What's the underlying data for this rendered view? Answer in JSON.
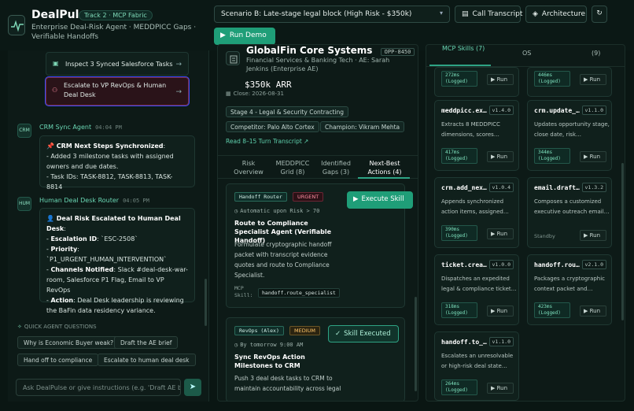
{
  "header": {
    "app_name": "DealPulse",
    "track_badge": "Track 2 · MCP Fabric",
    "subtitle": "Enterprise Deal-Risk Agent · MEDDPICC Gaps · Verifiable Handoffs",
    "scenario_select": "Scenario B: Late-stage legal block (High Risk - $350k)",
    "call_transcript_button": "Call Transcript",
    "architecture_button": "Architecture",
    "run_demo_button": "Run Demo"
  },
  "chat": {
    "tasks": [
      {
        "label": "Inspect 3 Synced Salesforce Tasks"
      },
      {
        "label": "Escalate to VP RevOps & Human Deal Desk"
      }
    ],
    "messages": [
      {
        "avatar": "CRM",
        "sender": "CRM Sync Agent",
        "time": "04:04 PM",
        "title": "📌 CRM Next Steps Synchronized",
        "lines": [
          "- Added 3 milestone tasks with assigned owners and due dates.",
          "- Task IDs: TASK-8812, TASK-8813, TASK-8814"
        ]
      },
      {
        "avatar": "HUM",
        "sender": "Human Deal Desk Router",
        "time": "04:05 PM",
        "title": "👤 Deal Risk Escalated to Human Deal Desk",
        "escalation_label": "Escalation ID",
        "escalation_value": "ESC-2508",
        "priority_label": "Priority",
        "priority_value": "P1_URGENT_HUMAN_INTERVENTION",
        "channels_label": "Channels Notified",
        "channels_value": "Slack #deal-desk-war-room, Salesforce P1 Flag, Email to VP RevOps",
        "action_label": "Action",
        "action_value": "Deal Desk leadership is reviewing the BaFin data residency variance."
      }
    ],
    "quick_questions_header": "QUICK AGENT QUESTIONS",
    "quick_questions": [
      "Why is Economic Buyer weak?",
      "Draft the AE brief",
      "Hand off to compliance",
      "Escalate to human deal desk"
    ],
    "input_placeholder": "Ask DealPulse or give instructions (e.g. 'Draft AE brie"
  },
  "account": {
    "name": "GlobalFin Core Systems",
    "id_badge": "OPP-8450",
    "industry_line": "Financial Services & Banking Tech · AE: Sarah Jenkins (Enterprise AE)",
    "arr": "$350k ARR",
    "close_date": "Close: 2026-08-31",
    "stage_chip": "Stage 4 - Legal & Security Contracting",
    "competitor_chip": "Competitor: Palo Alto Cortex",
    "champion_chip": "Champion: Vikram Mehta",
    "transcript_link": "Read 8–15 Turn Transcript ↗",
    "tabs": [
      {
        "label": "Risk Overview"
      },
      {
        "label": "MEDDPICC Grid (8)"
      },
      {
        "label": "Identified Gaps (3)"
      },
      {
        "label": "Next-Best Actions (4)"
      }
    ],
    "actions": [
      {
        "owner": "Handoff Router",
        "priority": "URGENT",
        "due": "Automatic upon Risk > 70",
        "title": "Route to Compliance Specialist Agent (Verifiable Handoff)",
        "description": "Formulate cryptographic handoff packet with transcript evidence quotes and route to Compliance Specialist.",
        "mcp_label": "MCP Skill:",
        "mcp_skill": "handoff.route_specialist",
        "button": "Execute Skill"
      },
      {
        "owner": "RevOps (Alex)",
        "priority": "MEDIUM",
        "due": "By tomorrow 9:00 AM",
        "title": "Sync RevOps Action Milestones to CRM",
        "description": "Push 3 deal desk tasks to CRM to maintain accountability across legal",
        "button": "Skill Executed"
      }
    ]
  },
  "skills_panel": {
    "tabs": [
      "MCP Skills (7)",
      "OS",
      "(9)"
    ],
    "skills": [
      {
        "name": "",
        "version": "",
        "desc": "",
        "log": "272ms (Logged)",
        "run": "Run"
      },
      {
        "name": "",
        "version": "",
        "desc": "",
        "log": "446ms (Logged)",
        "run": "Run"
      },
      {
        "name": "meddpicc.ex…",
        "version": "v1.4.0",
        "desc": "Extracts 8 MEDDPICC dimensions, scores…",
        "log": "417ms (Logged)",
        "run": "Run"
      },
      {
        "name": "crm.update_…",
        "version": "v1.1.0",
        "desc": "Updates opportunity stage, close date, risk…",
        "log": "344ms (Logged)",
        "run": "Run"
      },
      {
        "name": "crm.add_nex…",
        "version": "v1.0.4",
        "desc": "Appends synchronized action items, assigned…",
        "log": "390ms (Logged)",
        "run": "Run"
      },
      {
        "name": "email.draft…",
        "version": "v1.3.2",
        "desc": "Composes a customized executive outreach email…",
        "standby": "Standby",
        "run": "Run"
      },
      {
        "name": "ticket.crea…",
        "version": "v1.0.0",
        "desc": "Dispatches an expedited legal & compliance ticket…",
        "log": "318ms (Logged)",
        "run": "Run"
      },
      {
        "name": "handoff.rou…",
        "version": "v2.1.0",
        "desc": "Packages a cryptographic context packet and…",
        "log": "423ms (Logged)",
        "run": "Run"
      },
      {
        "name": "handoff.to_…",
        "version": "v1.1.0",
        "desc": "Escalates an unresolvable or high-risk deal state…",
        "log": "264ms (Logged)",
        "run": "Run"
      }
    ]
  },
  "colors": {
    "accent": "#1f9e78",
    "urgent": "#ff8da2",
    "medium": "#ffc66a",
    "background": "#0a1613"
  }
}
